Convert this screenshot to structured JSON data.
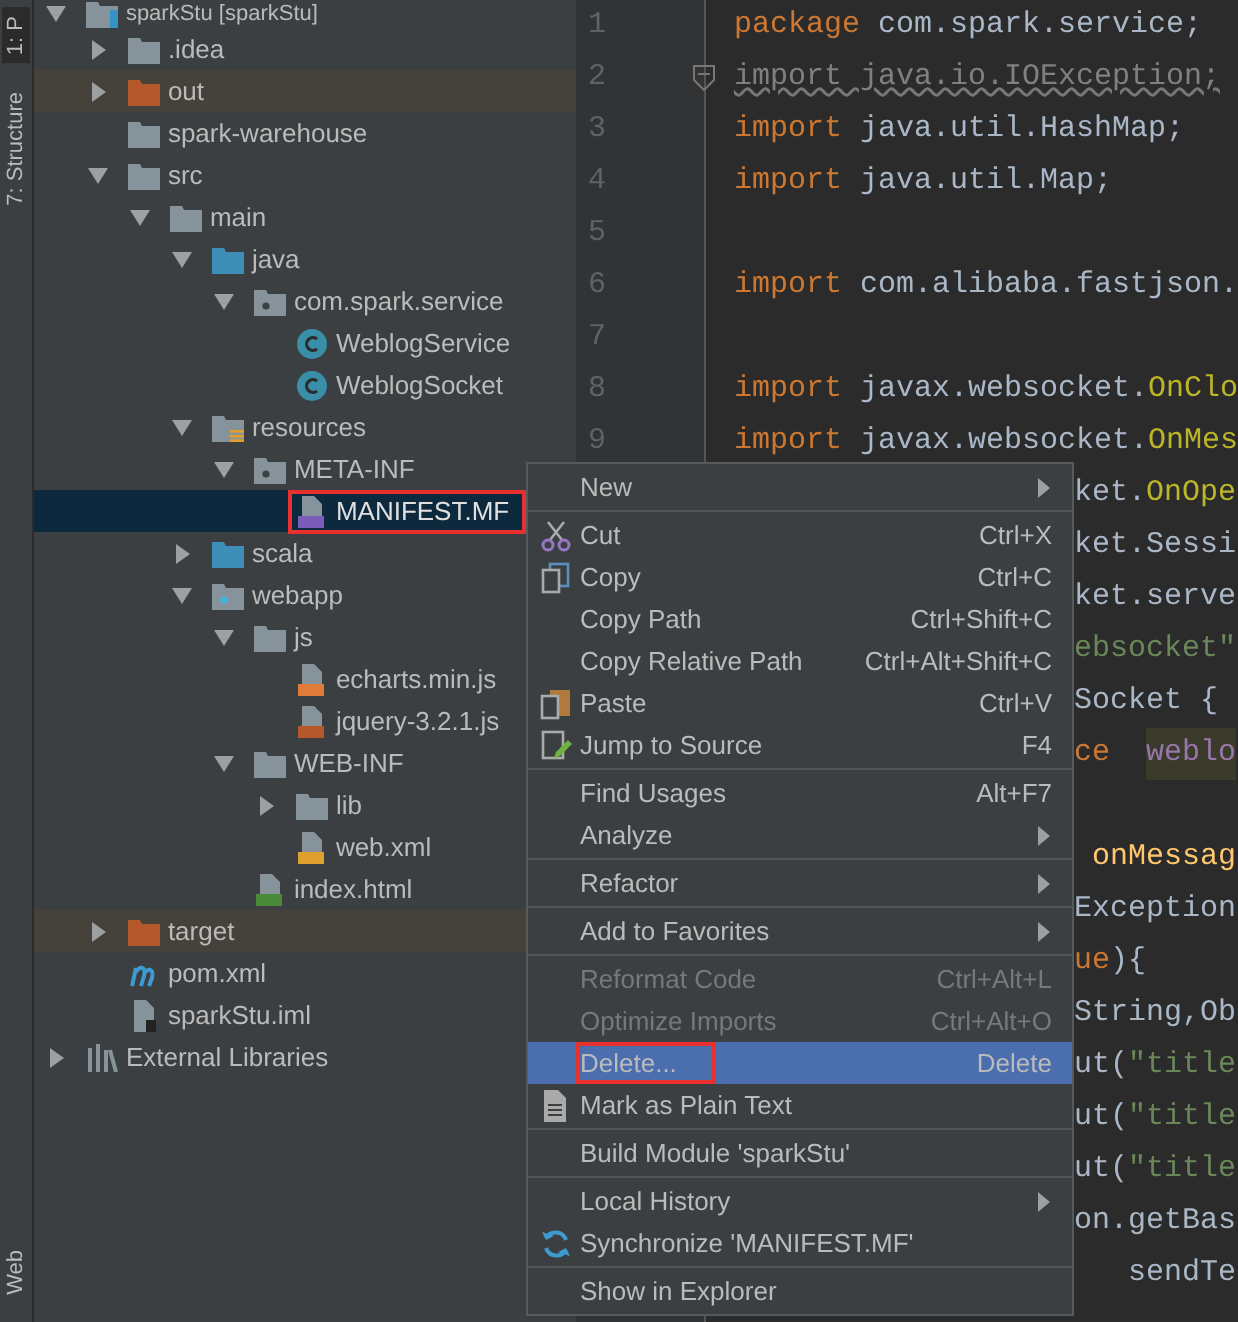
{
  "tool_strip": {
    "top_tabs": [
      {
        "label": "1: P",
        "selected": true
      },
      {
        "label": "7: Structure",
        "selected": false
      }
    ],
    "bottom_tabs": [
      {
        "label": "Web",
        "selected": false
      }
    ]
  },
  "tree": [
    {
      "label": "sparkStu [sparkStu]",
      "kind": "module",
      "expanded": true,
      "selected": false,
      "children": [
        {
          "label": ".idea",
          "kind": "folder",
          "expanded": false,
          "selected": false
        },
        {
          "label": "out",
          "kind": "excluded-folder",
          "expanded": false,
          "selected": false
        },
        {
          "label": "spark-warehouse",
          "kind": "folder",
          "selected": false
        },
        {
          "label": "src",
          "kind": "folder",
          "expanded": true,
          "selected": false,
          "children": [
            {
              "label": "main",
              "kind": "folder",
              "expanded": true,
              "selected": false,
              "children": [
                {
                  "label": "java",
                  "kind": "source-folder",
                  "expanded": true,
                  "selected": false,
                  "children": [
                    {
                      "label": "com.spark.service",
                      "kind": "package",
                      "expanded": true,
                      "selected": false,
                      "children": [
                        {
                          "label": "WeblogService",
                          "kind": "class",
                          "selected": false
                        },
                        {
                          "label": "WeblogSocket",
                          "kind": "class",
                          "selected": false
                        }
                      ]
                    }
                  ]
                },
                {
                  "label": "resources",
                  "kind": "resource-folder",
                  "expanded": true,
                  "selected": false,
                  "children": [
                    {
                      "label": "META-INF",
                      "kind": "package",
                      "expanded": true,
                      "selected": false,
                      "children": [
                        {
                          "label": "MANIFEST.MF",
                          "kind": "manifest",
                          "selected": true,
                          "outlined": true
                        }
                      ]
                    }
                  ]
                },
                {
                  "label": "scala",
                  "kind": "source-folder",
                  "expanded": false,
                  "selected": false
                },
                {
                  "label": "webapp",
                  "kind": "web-folder",
                  "expanded": true,
                  "selected": false,
                  "children": [
                    {
                      "label": "js",
                      "kind": "folder",
                      "expanded": true,
                      "selected": false,
                      "children": [
                        {
                          "label": "echarts.min.js",
                          "kind": "js-min",
                          "selected": false
                        },
                        {
                          "label": "jquery-3.2.1.js",
                          "kind": "js",
                          "selected": false
                        }
                      ]
                    },
                    {
                      "label": "WEB-INF",
                      "kind": "folder",
                      "expanded": true,
                      "selected": false,
                      "children": [
                        {
                          "label": "lib",
                          "kind": "folder",
                          "expanded": false,
                          "selected": false
                        },
                        {
                          "label": "web.xml",
                          "kind": "xml",
                          "selected": false
                        }
                      ]
                    },
                    {
                      "label": "index.html",
                      "kind": "html",
                      "selected": false
                    }
                  ]
                }
              ]
            }
          ]
        },
        {
          "label": "target",
          "kind": "excluded-folder",
          "expanded": false,
          "selected": false
        },
        {
          "label": "pom.xml",
          "kind": "pom",
          "selected": false
        },
        {
          "label": "sparkStu.iml",
          "kind": "iml",
          "selected": false
        }
      ]
    },
    {
      "label": "External Libraries",
      "kind": "libraries",
      "expanded": false,
      "selected": false
    }
  ],
  "editor": {
    "lines": [
      {
        "number": "1",
        "segments": [
          {
            "kind": "keyword",
            "text": "package"
          },
          {
            "kind": "plain",
            "text": " com.spark.service;"
          }
        ]
      },
      {
        "number": "2",
        "folded_marker": true,
        "segments": [
          {
            "kind": "unused",
            "text": "import java.io.IOException;"
          }
        ]
      },
      {
        "number": "3",
        "segments": [
          {
            "kind": "keyword",
            "text": "import"
          },
          {
            "kind": "plain",
            "text": " java.util.HashMap;"
          }
        ]
      },
      {
        "number": "4",
        "segments": [
          {
            "kind": "keyword",
            "text": "import"
          },
          {
            "kind": "plain",
            "text": " java.util.Map;"
          }
        ]
      },
      {
        "number": "5"
      },
      {
        "number": "6",
        "segments": [
          {
            "kind": "keyword",
            "text": "import"
          },
          {
            "kind": "plain",
            "text": " com.alibaba.fastjson."
          }
        ]
      },
      {
        "number": "7"
      },
      {
        "number": "8",
        "segments": [
          {
            "kind": "keyword",
            "text": "import"
          },
          {
            "kind": "plain",
            "text": " javax.websocket."
          },
          {
            "kind": "annotation",
            "text": "OnClo"
          }
        ]
      },
      {
        "number": "9",
        "segments": [
          {
            "kind": "keyword",
            "text": "import"
          },
          {
            "kind": "plain",
            "text": " javax.websocket."
          },
          {
            "kind": "annotation",
            "text": "OnMes"
          }
        ]
      }
    ],
    "covered_lines": [
      {
        "kind": "code",
        "segments": [
          {
            "kind": "plain",
            "text": "ket."
          },
          {
            "kind": "annotation",
            "text": "OnOpe"
          }
        ]
      },
      {
        "kind": "code",
        "segments": [
          {
            "kind": "plain",
            "text": "ket.Sessi"
          }
        ]
      },
      {
        "kind": "code",
        "segments": [
          {
            "kind": "plain",
            "text": "ket.serve"
          }
        ]
      },
      {
        "kind": "code",
        "segments": [
          {
            "kind": "string",
            "text": "ebsocket\""
          }
        ]
      },
      {
        "kind": "code",
        "segments": [
          {
            "kind": "plain",
            "text": "Socket {"
          }
        ]
      },
      {
        "kind": "code",
        "segments": [
          {
            "kind": "keyword",
            "text": "ce  "
          },
          {
            "kind": "field",
            "text": "weblo"
          }
        ]
      },
      {
        "kind": "blank"
      },
      {
        "kind": "code",
        "segments": [
          {
            "kind": "method",
            "text": " onMessag"
          }
        ]
      },
      {
        "kind": "code",
        "segments": [
          {
            "kind": "plain",
            "text": "Exception"
          }
        ]
      },
      {
        "kind": "code",
        "segments": [
          {
            "kind": "keyword",
            "text": "ue"
          },
          {
            "kind": "plain",
            "text": "){"
          }
        ]
      },
      {
        "kind": "code",
        "segments": [
          {
            "kind": "plain",
            "text": "String,Ob"
          }
        ]
      },
      {
        "kind": "code",
        "segments": [
          {
            "kind": "plain",
            "text": "ut("
          },
          {
            "kind": "string",
            "text": "\"title"
          }
        ]
      },
      {
        "kind": "code",
        "segments": [
          {
            "kind": "plain",
            "text": "ut("
          },
          {
            "kind": "string",
            "text": "\"title"
          }
        ]
      },
      {
        "kind": "code",
        "segments": [
          {
            "kind": "plain",
            "text": "ut("
          },
          {
            "kind": "string",
            "text": "\"title"
          }
        ]
      },
      {
        "kind": "code",
        "segments": [
          {
            "kind": "plain",
            "text": "on.getBas"
          }
        ]
      },
      {
        "kind": "code",
        "segments": [
          {
            "kind": "plain",
            "text": "   sendTe"
          }
        ]
      }
    ]
  },
  "context_menu": [
    {
      "kind": "item",
      "label": "New",
      "submenu": true,
      "disabled": false,
      "selected": false
    },
    {
      "kind": "separator"
    },
    {
      "kind": "cut",
      "label": "Cut",
      "shortcut": "Ctrl+X",
      "submenu": false,
      "disabled": false,
      "selected": false
    },
    {
      "kind": "copy",
      "label": "Copy",
      "shortcut": "Ctrl+C",
      "submenu": false,
      "disabled": false,
      "selected": false
    },
    {
      "kind": "item",
      "label": "Copy Path",
      "shortcut": "Ctrl+Shift+C",
      "submenu": false,
      "disabled": false,
      "selected": false
    },
    {
      "kind": "item",
      "label": "Copy Relative Path",
      "shortcut": "Ctrl+Alt+Shift+C",
      "submenu": false,
      "disabled": false,
      "selected": false
    },
    {
      "kind": "paste",
      "label": "Paste",
      "shortcut": "Ctrl+V",
      "submenu": false,
      "disabled": false,
      "selected": false
    },
    {
      "kind": "jump",
      "label": "Jump to Source",
      "shortcut": "F4",
      "submenu": false,
      "disabled": false,
      "selected": false
    },
    {
      "kind": "separator"
    },
    {
      "kind": "item",
      "label": "Find Usages",
      "shortcut": "Alt+F7",
      "submenu": false,
      "disabled": false,
      "selected": false
    },
    {
      "kind": "item",
      "label": "Analyze",
      "submenu": true,
      "disabled": false,
      "selected": false
    },
    {
      "kind": "separator"
    },
    {
      "kind": "item",
      "label": "Refactor",
      "submenu": true,
      "disabled": false,
      "selected": false
    },
    {
      "kind": "separator"
    },
    {
      "kind": "item",
      "label": "Add to Favorites",
      "submenu": true,
      "disabled": false,
      "selected": false
    },
    {
      "kind": "separator"
    },
    {
      "kind": "item",
      "label": "Reformat Code",
      "shortcut": "Ctrl+Alt+L",
      "submenu": false,
      "disabled": true,
      "selected": false
    },
    {
      "kind": "item",
      "label": "Optimize Imports",
      "shortcut": "Ctrl+Alt+O",
      "submenu": false,
      "disabled": true,
      "selected": false
    },
    {
      "kind": "item",
      "label": "Delete...",
      "shortcut": "Delete",
      "submenu": false,
      "disabled": false,
      "selected": true,
      "outlined": true
    },
    {
      "kind": "plain-text",
      "label": "Mark as Plain Text",
      "submenu": false,
      "disabled": false,
      "selected": false
    },
    {
      "kind": "separator"
    },
    {
      "kind": "item",
      "label": "Build Module 'sparkStu'",
      "submenu": false,
      "disabled": false,
      "selected": false
    },
    {
      "kind": "separator"
    },
    {
      "kind": "item",
      "label": "Local History",
      "submenu": true,
      "disabled": false,
      "selected": false
    },
    {
      "kind": "sync",
      "label": "Synchronize 'MANIFEST.MF'",
      "submenu": false,
      "disabled": false,
      "selected": false
    },
    {
      "kind": "separator"
    },
    {
      "kind": "item",
      "label": "Show in Explorer",
      "submenu": false,
      "disabled": false,
      "selected": false
    }
  ]
}
